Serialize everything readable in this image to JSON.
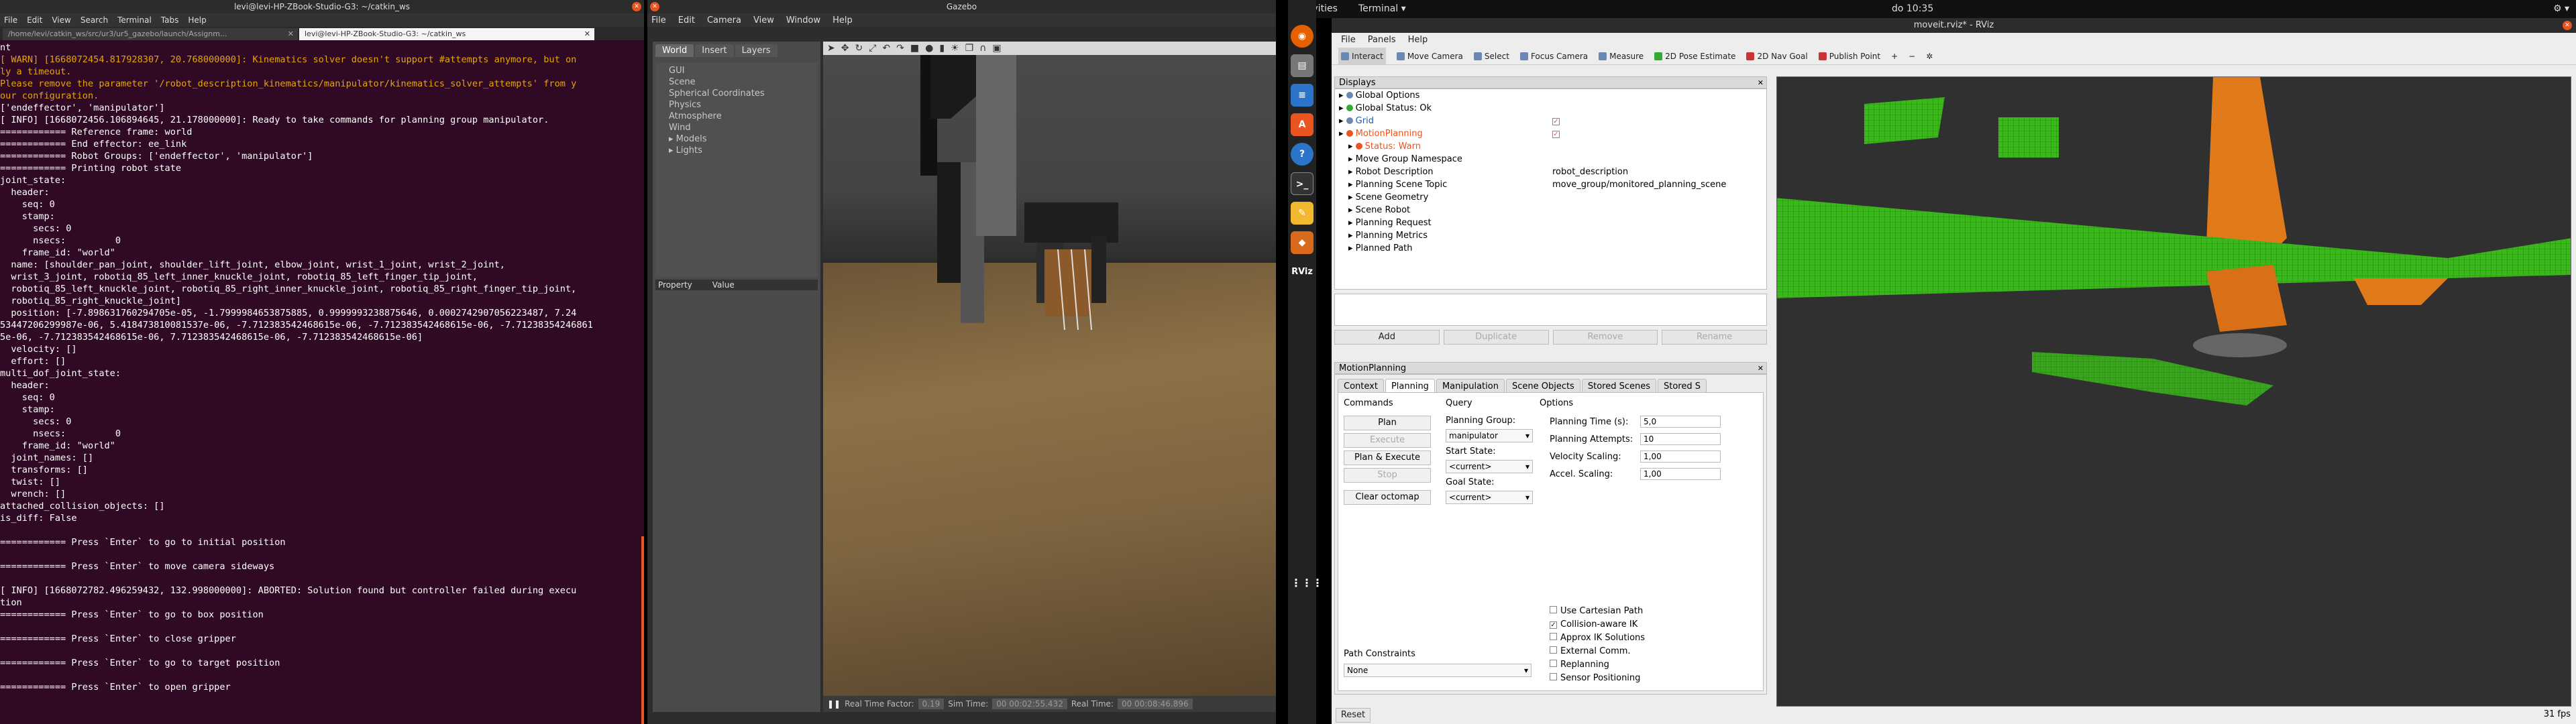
{
  "terminal": {
    "title": "levi@levi-HP-ZBook-Studio-G3: ~/catkin_ws",
    "menu": [
      "File",
      "Edit",
      "View",
      "Search",
      "Terminal",
      "Tabs",
      "Help"
    ],
    "tabs": [
      "/home/levi/catkin_ws/src/ur3/ur5_gazebo/launch/Assignm...",
      "levi@levi-HP-ZBook-Studio-G3: ~/catkin_ws"
    ],
    "lines": [
      {
        "t": "nt",
        "w": false
      },
      {
        "t": "[ WARN] [1668072454.817928307, 20.768000000]: Kinematics solver doesn't support #attempts anymore, but on",
        "w": true
      },
      {
        "t": "ly a timeout.",
        "w": true
      },
      {
        "t": "Please remove the parameter '/robot_description_kinematics/manipulator/kinematics_solver_attempts' from y",
        "w": true
      },
      {
        "t": "our configuration.",
        "w": true
      },
      {
        "t": "['endeffector', 'manipulator']",
        "w": false
      },
      {
        "t": "[ INFO] [1668072456.106894645, 21.178000000]: Ready to take commands for planning group manipulator.",
        "w": false
      },
      {
        "t": "============ Reference frame: world",
        "w": false
      },
      {
        "t": "============ End effector: ee_link",
        "w": false
      },
      {
        "t": "============ Robot Groups: ['endeffector', 'manipulator']",
        "w": false
      },
      {
        "t": "============ Printing robot state",
        "w": false
      },
      {
        "t": "joint_state:",
        "w": false
      },
      {
        "t": "  header:",
        "w": false
      },
      {
        "t": "    seq: 0",
        "w": false
      },
      {
        "t": "    stamp:",
        "w": false
      },
      {
        "t": "      secs: 0",
        "w": false
      },
      {
        "t": "      nsecs:         0",
        "w": false
      },
      {
        "t": "    frame_id: \"world\"",
        "w": false
      },
      {
        "t": "  name: [shoulder_pan_joint, shoulder_lift_joint, elbow_joint, wrist_1_joint, wrist_2_joint,",
        "w": false
      },
      {
        "t": "  wrist_3_joint, robotiq_85_left_inner_knuckle_joint, robotiq_85_left_finger_tip_joint,",
        "w": false
      },
      {
        "t": "  robotiq_85_left_knuckle_joint, robotiq_85_right_inner_knuckle_joint, robotiq_85_right_finger_tip_joint,",
        "w": false
      },
      {
        "t": "  robotiq_85_right_knuckle_joint]",
        "w": false
      },
      {
        "t": "  position: [-7.898631760294705e-05, -1.7999984653875885, 0.9999993238875646, 0.0002742907056223487, 7.24",
        "w": false
      },
      {
        "t": "53447206299987e-06, 5.418473810081537e-06, -7.712383542468615e-06, -7.712383542468615e-06, -7.71238354246861",
        "w": false
      },
      {
        "t": "5e-06, -7.712383542468615e-06, 7.712383542468615e-06, -7.712383542468615e-06]",
        "w": false
      },
      {
        "t": "  velocity: []",
        "w": false
      },
      {
        "t": "  effort: []",
        "w": false
      },
      {
        "t": "multi_dof_joint_state:",
        "w": false
      },
      {
        "t": "  header:",
        "w": false
      },
      {
        "t": "    seq: 0",
        "w": false
      },
      {
        "t": "    stamp:",
        "w": false
      },
      {
        "t": "      secs: 0",
        "w": false
      },
      {
        "t": "      nsecs:         0",
        "w": false
      },
      {
        "t": "    frame_id: \"world\"",
        "w": false
      },
      {
        "t": "  joint_names: []",
        "w": false
      },
      {
        "t": "  transforms: []",
        "w": false
      },
      {
        "t": "  twist: []",
        "w": false
      },
      {
        "t": "  wrench: []",
        "w": false
      },
      {
        "t": "attached_collision_objects: []",
        "w": false
      },
      {
        "t": "is_diff: False",
        "w": false
      },
      {
        "t": "",
        "w": false
      },
      {
        "t": "============ Press `Enter` to go to initial position",
        "w": false
      },
      {
        "t": "",
        "w": false
      },
      {
        "t": "============ Press `Enter` to move camera sideways",
        "w": false
      },
      {
        "t": "",
        "w": false
      },
      {
        "t": "[ INFO] [1668072782.496259432, 132.998000000]: ABORTED: Solution found but controller failed during execu",
        "w": false
      },
      {
        "t": "tion",
        "w": false
      },
      {
        "t": "============ Press `Enter` to go to box position",
        "w": false
      },
      {
        "t": "",
        "w": false
      },
      {
        "t": "============ Press `Enter` to close gripper",
        "w": false
      },
      {
        "t": "",
        "w": false
      },
      {
        "t": "============ Press `Enter` to go to target position",
        "w": false
      },
      {
        "t": "",
        "w": false
      },
      {
        "t": "============ Press `Enter` to open gripper",
        "w": false
      }
    ]
  },
  "gazebo": {
    "title": "Gazebo",
    "menu": [
      "File",
      "Edit",
      "Camera",
      "View",
      "Window",
      "Help"
    ],
    "tabs": [
      "World",
      "Insert",
      "Layers"
    ],
    "tree": [
      "GUI",
      "Scene",
      "Spherical Coordinates",
      "Physics",
      "Atmosphere",
      "Wind",
      "Models",
      "Lights"
    ],
    "prop_headers": [
      "Property",
      "Value"
    ],
    "status": {
      "rtf_label": "Real Time Factor:",
      "rtf": "0.19",
      "sim_label": "Sim Time:",
      "sim": "00 00:02:55.432",
      "real_label": "Real Time:",
      "real": "00 00:08:46.896"
    }
  },
  "topbar": {
    "activities": "Activities",
    "app": "Terminal ▾",
    "clock": "do 10:35"
  },
  "dock": {
    "rviz": "RViz"
  },
  "rviz": {
    "title": "moveit.rviz* - RViz",
    "menu": [
      "File",
      "Panels",
      "Help"
    ],
    "tools": [
      "Interact",
      "Move Camera",
      "Select",
      "Focus Camera",
      "Measure",
      "2D Pose Estimate",
      "2D Nav Goal",
      "Publish Point"
    ],
    "displays_title": "Displays",
    "displays": [
      {
        "k": "Global Options",
        "v": "",
        "c": "#6b87b3"
      },
      {
        "k": "Global Status: Ok",
        "v": "",
        "c": "#3a3"
      },
      {
        "k": "Grid",
        "v": "✓",
        "c": "#6b87b3"
      },
      {
        "k": "MotionPlanning",
        "v": "✓",
        "c": "#e95420"
      },
      {
        "k": "Status: Warn",
        "v": "",
        "c": "#e95420"
      },
      {
        "k": "Move Group Namespace",
        "v": "",
        "c": ""
      },
      {
        "k": "Robot Description",
        "v": "robot_description",
        "c": ""
      },
      {
        "k": "Planning Scene Topic",
        "v": "move_group/monitored_planning_scene",
        "c": ""
      },
      {
        "k": "Scene Geometry",
        "v": "",
        "c": ""
      },
      {
        "k": "Scene Robot",
        "v": "",
        "c": ""
      },
      {
        "k": "Planning Request",
        "v": "",
        "c": ""
      },
      {
        "k": "Planning Metrics",
        "v": "",
        "c": ""
      },
      {
        "k": "Planned Path",
        "v": "",
        "c": ""
      }
    ],
    "disp_btns": [
      "Add",
      "Duplicate",
      "Remove",
      "Rename"
    ],
    "mp_title": "MotionPlanning",
    "mp_tabs": [
      "Context",
      "Planning",
      "Manipulation",
      "Scene Objects",
      "Stored Scenes",
      "Stored S"
    ],
    "commands": "Commands",
    "query": "Query",
    "options": "Options",
    "btn_plan": "Plan",
    "btn_execute": "Execute",
    "btn_planexec": "Plan & Execute",
    "btn_stop": "Stop",
    "btn_clear": "Clear octomap",
    "planning_group_label": "Planning Group:",
    "planning_group": "manipulator",
    "start_label": "Start State:",
    "start": "<current>",
    "goal_label": "Goal State:",
    "goal": "<current>",
    "ptime_label": "Planning Time (s):",
    "ptime": "5,0",
    "pattempts_label": "Planning Attempts:",
    "pattempts": "10",
    "vel_label": "Velocity Scaling:",
    "vel": "1,00",
    "acc_label": "Accel. Scaling:",
    "acc": "1,00",
    "checks": [
      {
        "l": "Use Cartesian Path",
        "v": false
      },
      {
        "l": "Collision-aware IK",
        "v": true
      },
      {
        "l": "Approx IK Solutions",
        "v": false
      },
      {
        "l": "External Comm.",
        "v": false
      },
      {
        "l": "Replanning",
        "v": false
      },
      {
        "l": "Sensor Positioning",
        "v": false
      }
    ],
    "constraints_label": "Path Constraints",
    "constraints": "None",
    "reset": "Reset",
    "fps": "31 fps"
  }
}
